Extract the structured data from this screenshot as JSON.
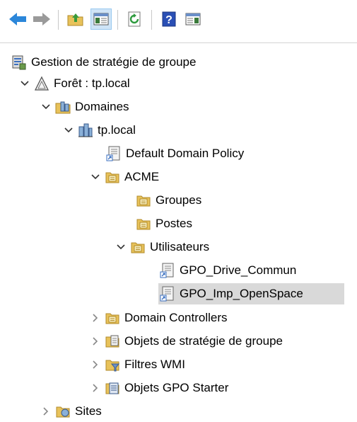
{
  "toolbar": {
    "buttons": [
      {
        "icon": "back-arrow-icon"
      },
      {
        "icon": "forward-arrow-icon"
      },
      {
        "icon": "up-folder-icon"
      },
      {
        "icon": "show-hide-console-tree-icon"
      },
      {
        "icon": "refresh-icon"
      },
      {
        "icon": "help-icon"
      },
      {
        "icon": "show-hide-action-pane-icon"
      }
    ]
  },
  "tree": {
    "root": "Gestion de stratégie de groupe",
    "forest": "Forêt : tp.local",
    "domains": "Domaines",
    "domain": "tp.local",
    "default_policy": "Default Domain Policy",
    "acme": "ACME",
    "groupes": "Groupes",
    "postes": "Postes",
    "utilisateurs": "Utilisateurs",
    "gpo_drive": "GPO_Drive_Commun",
    "gpo_imp": "GPO_Imp_OpenSpace",
    "domain_controllers": "Domain Controllers",
    "gpo_objects": "Objets de stratégie de groupe",
    "wmi_filters": "Filtres WMI",
    "starter_gpos": "Objets GPO Starter",
    "sites": "Sites"
  },
  "colors": {
    "selection": "#d9d9d9",
    "folder": "#e8c25a",
    "arrow_blue": "#2b86d9"
  }
}
